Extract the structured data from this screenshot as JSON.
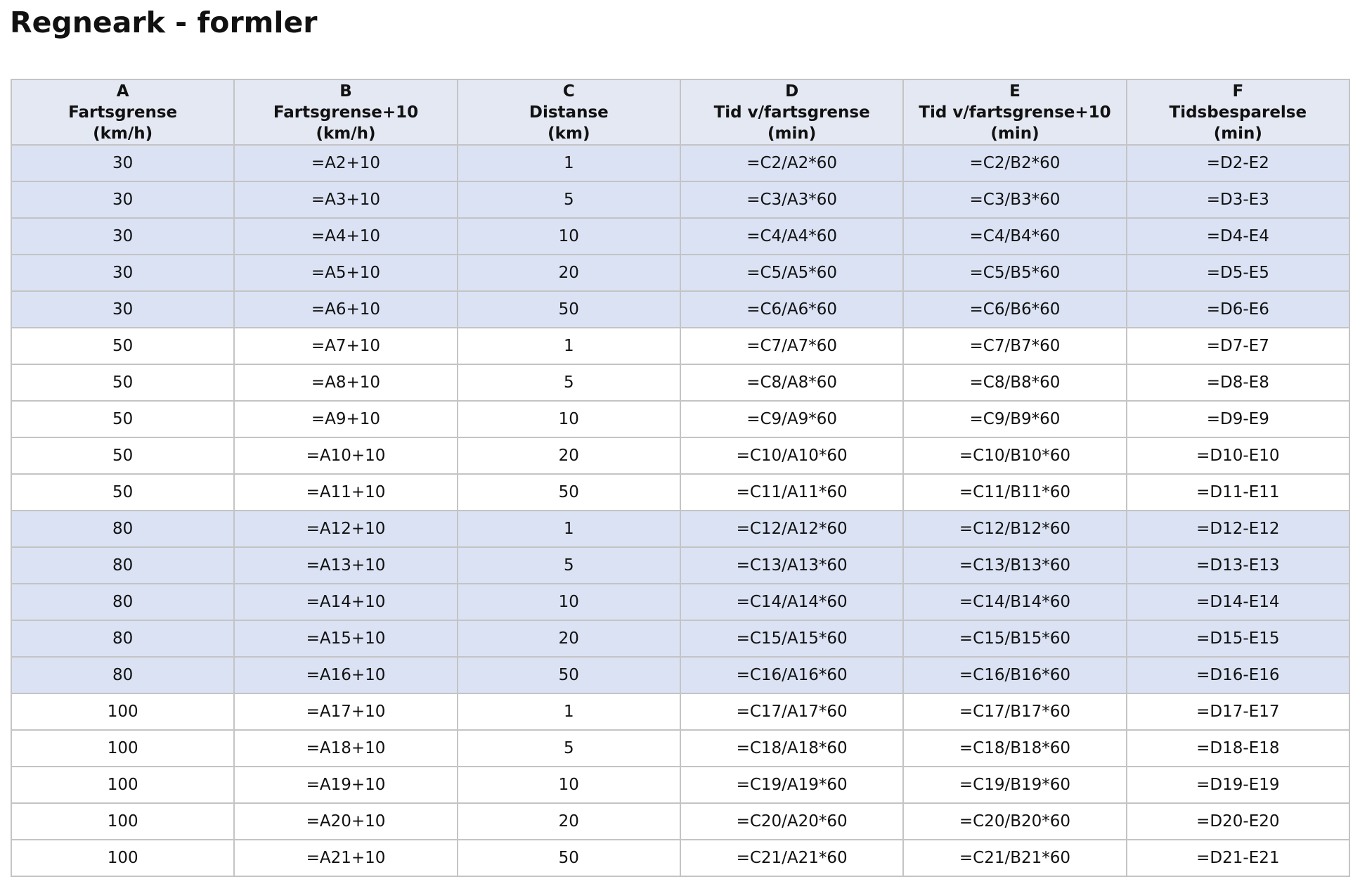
{
  "title": "Regneark - formler",
  "colors": {
    "header_bg": "#e4e8f2",
    "band_blue": "#dae2f4",
    "band_white": "#ffffff",
    "grid_line": "#c4c4c4"
  },
  "columns": [
    {
      "letter": "A",
      "name": "Fartsgrense",
      "unit": "(km/h)"
    },
    {
      "letter": "B",
      "name": "Fartsgrense+10",
      "unit": "(km/h)"
    },
    {
      "letter": "C",
      "name": "Distanse",
      "unit": "(km)"
    },
    {
      "letter": "D",
      "name": "Tid v/fartsgrense",
      "unit": "(min)"
    },
    {
      "letter": "E",
      "name": "Tid v/fartsgrense+10",
      "unit": "(min)"
    },
    {
      "letter": "F",
      "name": "Tidsbesparelse",
      "unit": "(min)"
    }
  ],
  "rows": [
    {
      "band": "blue",
      "cells": [
        "30",
        "=A2+10",
        "1",
        "=C2/A2*60",
        "=C2/B2*60",
        "=D2-E2"
      ]
    },
    {
      "band": "blue",
      "cells": [
        "30",
        "=A3+10",
        "5",
        "=C3/A3*60",
        "=C3/B3*60",
        "=D3-E3"
      ]
    },
    {
      "band": "blue",
      "cells": [
        "30",
        "=A4+10",
        "10",
        "=C4/A4*60",
        "=C4/B4*60",
        "=D4-E4"
      ]
    },
    {
      "band": "blue",
      "cells": [
        "30",
        "=A5+10",
        "20",
        "=C5/A5*60",
        "=C5/B5*60",
        "=D5-E5"
      ]
    },
    {
      "band": "blue",
      "cells": [
        "30",
        "=A6+10",
        "50",
        "=C6/A6*60",
        "=C6/B6*60",
        "=D6-E6"
      ]
    },
    {
      "band": "white",
      "cells": [
        "50",
        "=A7+10",
        "1",
        "=C7/A7*60",
        "=C7/B7*60",
        "=D7-E7"
      ]
    },
    {
      "band": "white",
      "cells": [
        "50",
        "=A8+10",
        "5",
        "=C8/A8*60",
        "=C8/B8*60",
        "=D8-E8"
      ]
    },
    {
      "band": "white",
      "cells": [
        "50",
        "=A9+10",
        "10",
        "=C9/A9*60",
        "=C9/B9*60",
        "=D9-E9"
      ]
    },
    {
      "band": "white",
      "cells": [
        "50",
        "=A10+10",
        "20",
        "=C10/A10*60",
        "=C10/B10*60",
        "=D10-E10"
      ]
    },
    {
      "band": "white",
      "cells": [
        "50",
        "=A11+10",
        "50",
        "=C11/A11*60",
        "=C11/B11*60",
        "=D11-E11"
      ]
    },
    {
      "band": "blue",
      "cells": [
        "80",
        "=A12+10",
        "1",
        "=C12/A12*60",
        "=C12/B12*60",
        "=D12-E12"
      ]
    },
    {
      "band": "blue",
      "cells": [
        "80",
        "=A13+10",
        "5",
        "=C13/A13*60",
        "=C13/B13*60",
        "=D13-E13"
      ]
    },
    {
      "band": "blue",
      "cells": [
        "80",
        "=A14+10",
        "10",
        "=C14/A14*60",
        "=C14/B14*60",
        "=D14-E14"
      ]
    },
    {
      "band": "blue",
      "cells": [
        "80",
        "=A15+10",
        "20",
        "=C15/A15*60",
        "=C15/B15*60",
        "=D15-E15"
      ]
    },
    {
      "band": "blue",
      "cells": [
        "80",
        "=A16+10",
        "50",
        "=C16/A16*60",
        "=C16/B16*60",
        "=D16-E16"
      ]
    },
    {
      "band": "white",
      "cells": [
        "100",
        "=A17+10",
        "1",
        "=C17/A17*60",
        "=C17/B17*60",
        "=D17-E17"
      ]
    },
    {
      "band": "white",
      "cells": [
        "100",
        "=A18+10",
        "5",
        "=C18/A18*60",
        "=C18/B18*60",
        "=D18-E18"
      ]
    },
    {
      "band": "white",
      "cells": [
        "100",
        "=A19+10",
        "10",
        "=C19/A19*60",
        "=C19/B19*60",
        "=D19-E19"
      ]
    },
    {
      "band": "white",
      "cells": [
        "100",
        "=A20+10",
        "20",
        "=C20/A20*60",
        "=C20/B20*60",
        "=D20-E20"
      ]
    },
    {
      "band": "white",
      "cells": [
        "100",
        "=A21+10",
        "50",
        "=C21/A21*60",
        "=C21/B21*60",
        "=D21-E21"
      ]
    }
  ]
}
